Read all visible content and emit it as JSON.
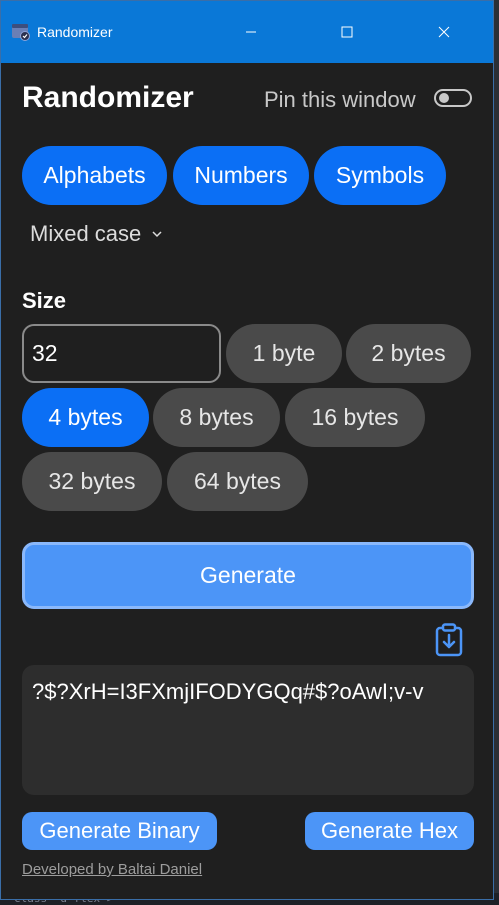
{
  "window": {
    "title": "Randomizer"
  },
  "header": {
    "title": "Randomizer",
    "pin_label": "Pin this window",
    "pin_enabled": false
  },
  "charset": {
    "options": [
      "Alphabets",
      "Numbers",
      "Symbols"
    ],
    "case_select": "Mixed case"
  },
  "size": {
    "label": "Size",
    "value": "32",
    "presets": [
      "1 byte",
      "2 bytes",
      "4 bytes",
      "8 bytes",
      "16 bytes",
      "32 bytes",
      "64 bytes"
    ],
    "selected": "4 bytes"
  },
  "actions": {
    "generate": "Generate",
    "generate_binary": "Generate Binary",
    "generate_hex": "Generate Hex"
  },
  "output": {
    "value": "?$?XrH=I3FXmjIFODYGQq#$?oAwI;v-v"
  },
  "footer": {
    "credit": "Developed by Baltai Daniel"
  },
  "background": {
    "code_fragment": "class= d-flex >"
  },
  "colors": {
    "accent": "#0b6ff5",
    "accent_light": "#4c95f7",
    "titlebar": "#0a78d7",
    "background": "#1f1f1f",
    "pill_gray": "#4a4a4a"
  },
  "icons": [
    "app-icon",
    "minimize-icon",
    "maximize-icon",
    "close-icon",
    "chevron-down-icon",
    "clipboard-download-icon"
  ]
}
